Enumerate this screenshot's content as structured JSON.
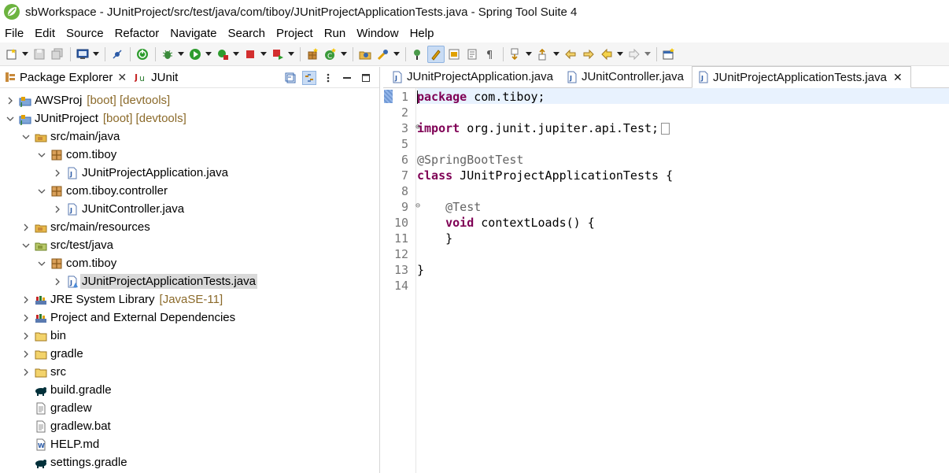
{
  "window": {
    "title": "sbWorkspace - JUnitProject/src/test/java/com/tiboy/JUnitProjectApplicationTests.java - Spring Tool Suite 4"
  },
  "menubar": {
    "items": [
      "File",
      "Edit",
      "Source",
      "Refactor",
      "Navigate",
      "Search",
      "Project",
      "Run",
      "Window",
      "Help"
    ]
  },
  "left_panel": {
    "tabs": [
      {
        "label": "Package Explorer",
        "icon": "package-explorer-icon",
        "active": true
      },
      {
        "label": "JUnit",
        "icon": "junit-icon",
        "active": false
      }
    ],
    "tree": [
      {
        "label": "AWSProj",
        "deco": "[boot] [devtools]",
        "icon": "project-icon",
        "indent": 0,
        "expanded": false,
        "chevron": true
      },
      {
        "label": "JUnitProject",
        "deco": "[boot] [devtools]",
        "icon": "project-icon",
        "indent": 0,
        "expanded": true,
        "chevron": true
      },
      {
        "label": "src/main/java",
        "deco": "",
        "icon": "source-folder-icon",
        "indent": 1,
        "expanded": true,
        "chevron": true
      },
      {
        "label": "com.tiboy",
        "deco": "",
        "icon": "package-icon",
        "indent": 2,
        "expanded": true,
        "chevron": true
      },
      {
        "label": "JUnitProjectApplication.java",
        "deco": "",
        "icon": "java-file-icon",
        "indent": 3,
        "expanded": false,
        "chevron": true
      },
      {
        "label": "com.tiboy.controller",
        "deco": "",
        "icon": "package-icon",
        "indent": 2,
        "expanded": true,
        "chevron": true
      },
      {
        "label": "JUnitController.java",
        "deco": "",
        "icon": "java-file-icon",
        "indent": 3,
        "expanded": false,
        "chevron": true
      },
      {
        "label": "src/main/resources",
        "deco": "",
        "icon": "source-folder-icon",
        "indent": 1,
        "expanded": false,
        "chevron": true
      },
      {
        "label": "src/test/java",
        "deco": "",
        "icon": "test-source-folder-icon",
        "indent": 1,
        "expanded": true,
        "chevron": true
      },
      {
        "label": "com.tiboy",
        "deco": "",
        "icon": "package-icon",
        "indent": 2,
        "expanded": true,
        "chevron": true
      },
      {
        "label": "JUnitProjectApplicationTests.java",
        "deco": "",
        "icon": "java-test-file-icon",
        "indent": 3,
        "expanded": false,
        "chevron": true,
        "selected": true
      },
      {
        "label": "JRE System Library",
        "deco": "[JavaSE-11]",
        "icon": "library-icon",
        "indent": 1,
        "expanded": false,
        "chevron": true
      },
      {
        "label": "Project and External Dependencies",
        "deco": "",
        "icon": "library-icon",
        "indent": 1,
        "expanded": false,
        "chevron": true
      },
      {
        "label": "bin",
        "deco": "",
        "icon": "folder-icon",
        "indent": 1,
        "expanded": false,
        "chevron": true
      },
      {
        "label": "gradle",
        "deco": "",
        "icon": "folder-icon",
        "indent": 1,
        "expanded": false,
        "chevron": true
      },
      {
        "label": "src",
        "deco": "",
        "icon": "folder-icon",
        "indent": 1,
        "expanded": false,
        "chevron": true
      },
      {
        "label": "build.gradle",
        "deco": "",
        "icon": "gradle-file-icon",
        "indent": 1,
        "expanded": false,
        "chevron": false
      },
      {
        "label": "gradlew",
        "deco": "",
        "icon": "text-file-icon",
        "indent": 1,
        "expanded": false,
        "chevron": false
      },
      {
        "label": "gradlew.bat",
        "deco": "",
        "icon": "text-file-icon",
        "indent": 1,
        "expanded": false,
        "chevron": false
      },
      {
        "label": "HELP.md",
        "deco": "",
        "icon": "markdown-file-icon",
        "indent": 1,
        "expanded": false,
        "chevron": false
      },
      {
        "label": "settings.gradle",
        "deco": "",
        "icon": "gradle-file-icon",
        "indent": 1,
        "expanded": false,
        "chevron": false
      }
    ]
  },
  "editor": {
    "tabs": [
      {
        "label": "JUnitProjectApplication.java",
        "active": false
      },
      {
        "label": "JUnitController.java",
        "active": false
      },
      {
        "label": "JUnitProjectApplicationTests.java",
        "active": true
      }
    ],
    "lines": [
      {
        "n": "1",
        "fold": "",
        "tokens": [
          [
            "kw",
            "package"
          ],
          [
            "t",
            " com.tiboy;"
          ]
        ],
        "caret": true
      },
      {
        "n": "2",
        "fold": "",
        "tokens": []
      },
      {
        "n": "3",
        "fold": "⊕",
        "tokens": [
          [
            "kw",
            "import"
          ],
          [
            "t",
            " org.junit.jupiter.api.Test;"
          ]
        ],
        "foldbox": true
      },
      {
        "n": "5",
        "fold": "",
        "tokens": []
      },
      {
        "n": "6",
        "fold": "",
        "tokens": [
          [
            "ann",
            "@SpringBootTest"
          ]
        ]
      },
      {
        "n": "7",
        "fold": "",
        "tokens": [
          [
            "kw",
            "class"
          ],
          [
            "t",
            " JUnitProjectApplicationTests {"
          ]
        ]
      },
      {
        "n": "8",
        "fold": "",
        "tokens": []
      },
      {
        "n": "9",
        "fold": "⊖",
        "tokens": [
          [
            "t",
            "    "
          ],
          [
            "ann",
            "@Test"
          ]
        ]
      },
      {
        "n": "10",
        "fold": "",
        "tokens": [
          [
            "t",
            "    "
          ],
          [
            "kw",
            "void"
          ],
          [
            "t",
            " contextLoads() {"
          ]
        ]
      },
      {
        "n": "11",
        "fold": "",
        "tokens": [
          [
            "t",
            "    }"
          ]
        ]
      },
      {
        "n": "12",
        "fold": "",
        "tokens": []
      },
      {
        "n": "13",
        "fold": "",
        "tokens": [
          [
            "t",
            "}"
          ]
        ]
      },
      {
        "n": "14",
        "fold": "",
        "tokens": []
      }
    ]
  },
  "colors": {
    "keyword": "#7f0055",
    "annotation": "#646464",
    "selection": "#d9d9d9",
    "current_line": "#e8f2fe",
    "decoration": "#8b6a2a"
  }
}
